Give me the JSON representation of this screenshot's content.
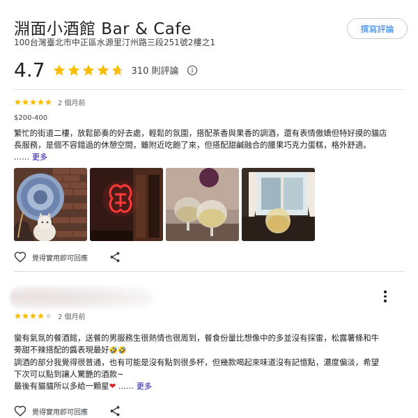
{
  "place": {
    "title": "淵面小酒館 Bar & Cafe",
    "address": "100台灣臺北市中正區水源里汀州路三段251號2樓之1",
    "write_review_label": "撰寫評論"
  },
  "rating": {
    "value": "4.7",
    "stars": 4.7,
    "count_label": "310 則評論",
    "star_color": "#fbbc04"
  },
  "reviews": [
    {
      "stars": 5,
      "time": "2 個月前",
      "price": "$200-400",
      "text": "繁忙的街道二樓，放鬆節奏的好去處，輕鬆的氛圍，搭配茶香與果香的調酒，還有表情傲嬌但特好摸的貓店長服務，是個不容錯過的休憩空間，雖附近吃飽了來，但搭配甜鹹融合的腰果巧克力蛋糕，格外舒適。",
      "more_prefix": "……",
      "more_label": "更多",
      "photos": [
        "cat-and-decor-photo",
        "red-neon-sign-photo",
        "cocktail-glasses-photo",
        "drink-by-window-photo"
      ],
      "like_label": "覺得實用",
      "like_hint": "即可回應"
    },
    {
      "stars": 4,
      "time": "2 個月前",
      "text_lines": [
        "蠻有氣氛的餐酒館，送餐的男服務生很熱情也很周到，餐食份量比想像中的多並沒有採雷，松露薯條和牛",
        "蒡甜不辣搭配的醬表現最好",
        "調酒的部分我覺得很普通，也有可能是沒有點到很多杯，但幾款喝起來味道沒有記憶點，濃度偏淡，希望",
        "下次可以點到讓人驚艷的酒款~",
        "最後有貓貓所以多給一顆星"
      ],
      "emoji_1": "🤣",
      "emoji_2": "🤣",
      "heart": "❤",
      "more_prefix": "……",
      "more_label": "更多",
      "like_label": "覺得實用",
      "like_hint": "即可回應"
    }
  ]
}
